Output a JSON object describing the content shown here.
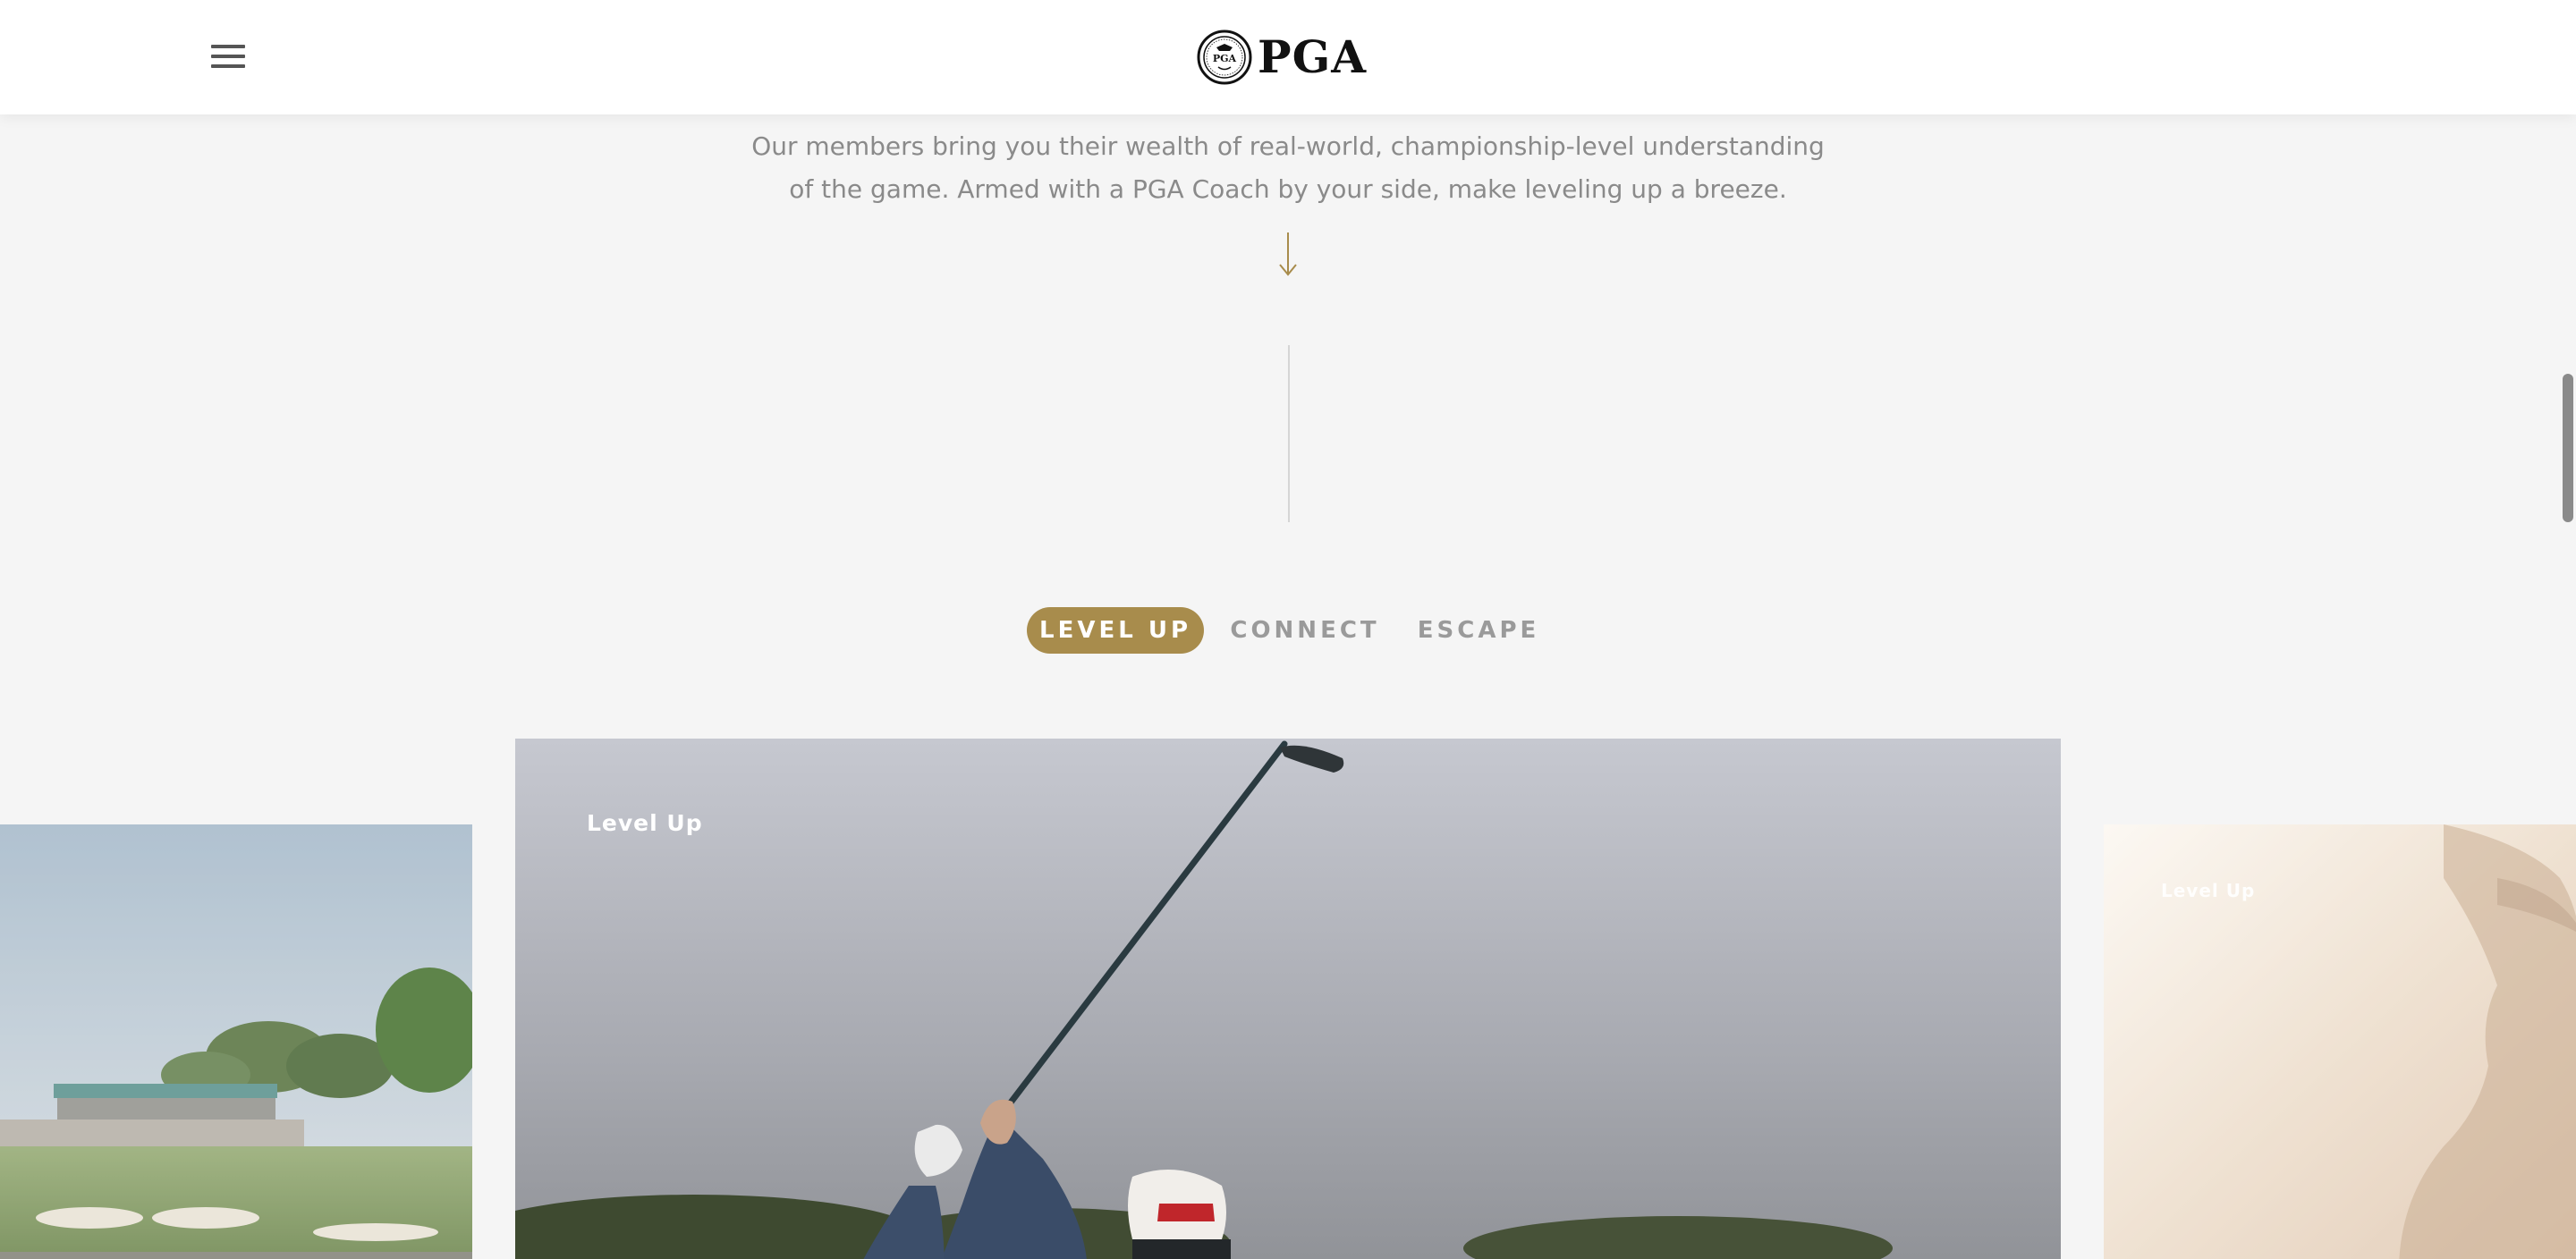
{
  "header": {
    "menu_icon": "hamburger-menu-icon",
    "logo_text": "PGA",
    "logo_seal_text": "PGA"
  },
  "intro": {
    "text": "Our members bring you their wealth of real-world, championship-level understanding of the game. Armed with a PGA Coach by your side, make leveling up a breeze."
  },
  "tabs": [
    {
      "label": "LEVEL UP",
      "active": true
    },
    {
      "label": "CONNECT",
      "active": false
    },
    {
      "label": "ESCAPE",
      "active": false
    }
  ],
  "carousel": {
    "cards": [
      {
        "label": ""
      },
      {
        "label": "Level Up"
      },
      {
        "label": "Level Up"
      }
    ]
  },
  "colors": {
    "accent": "#a88c4c",
    "background": "#f5f5f5",
    "body_text": "#8a8a8a",
    "inactive_tab": "#9a9a9a"
  }
}
